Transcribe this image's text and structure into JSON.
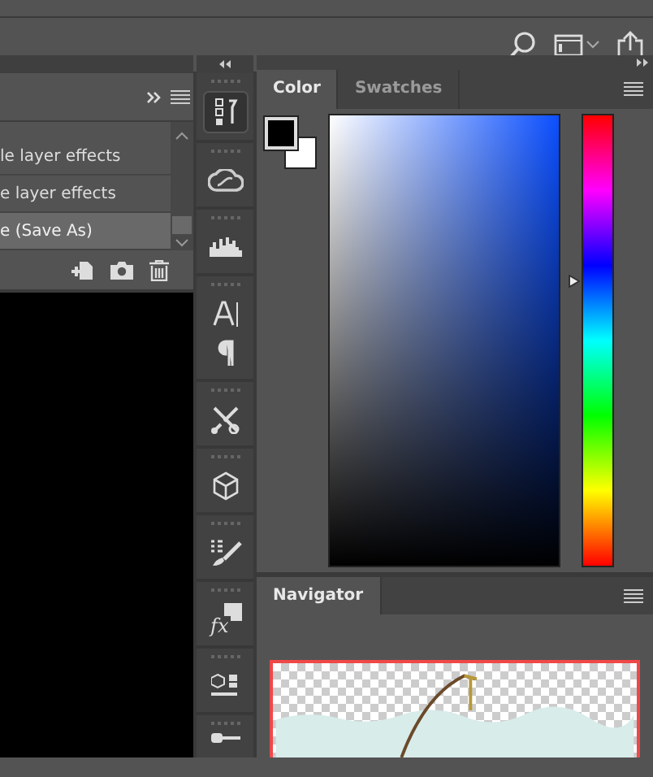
{
  "history_panel": {
    "items": [
      {
        "label": "le layer effects",
        "selected": false
      },
      {
        "label": "e layer effects",
        "selected": false
      },
      {
        "label": "e (Save As)",
        "selected": true
      }
    ]
  },
  "color_panel": {
    "tabs": [
      {
        "label": "Color",
        "selected": true
      },
      {
        "label": "Swatches",
        "selected": false
      }
    ],
    "hue_slider": {
      "level": 0.63
    }
  },
  "dock": {
    "effects_button": "fx"
  },
  "navigator_panel": {
    "tabs": [
      {
        "label": "Navigator",
        "selected": true
      }
    ]
  }
}
